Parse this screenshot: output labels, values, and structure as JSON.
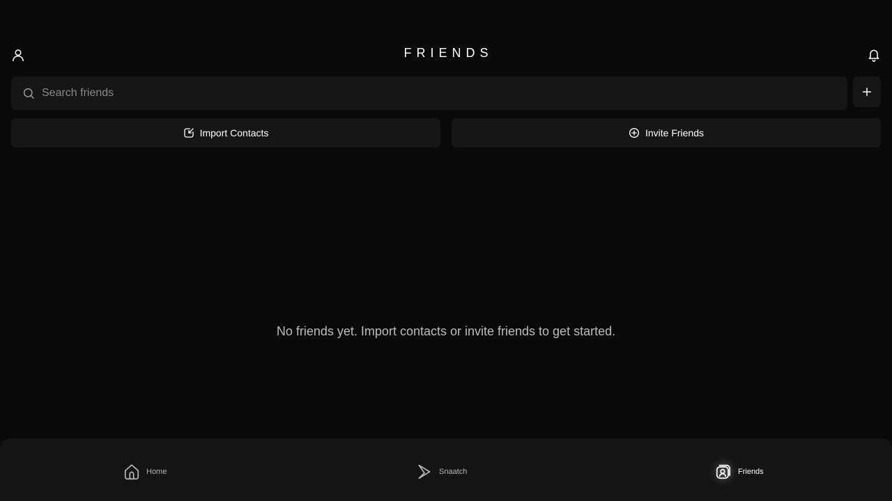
{
  "header": {
    "title": "FRIENDS",
    "profile_icon": "user-icon",
    "notification_icon": "bell-icon"
  },
  "search": {
    "placeholder": "Search friends",
    "value": "",
    "icon": "search-icon",
    "add_icon": "plus-icon"
  },
  "actions": {
    "import_label": "Import Contacts",
    "import_icon": "import-contacts-icon",
    "invite_label": "Invite Friends",
    "invite_icon": "plus-circle-icon"
  },
  "empty_state": {
    "message": "No friends yet. Import contacts or invite friends to get started."
  },
  "bottom_nav": {
    "items": [
      {
        "label": "Home",
        "icon": "home-icon",
        "active": false
      },
      {
        "label": "Snaatch",
        "icon": "snaatch-icon",
        "active": false
      },
      {
        "label": "Friends",
        "icon": "friends-icon",
        "active": true
      }
    ]
  },
  "colors": {
    "background": "#0a0a0a",
    "surface": "#161616",
    "nav_background": "#141414",
    "text_primary": "#ffffff",
    "text_muted": "#bdbdbd",
    "placeholder": "#8a8a8a"
  }
}
